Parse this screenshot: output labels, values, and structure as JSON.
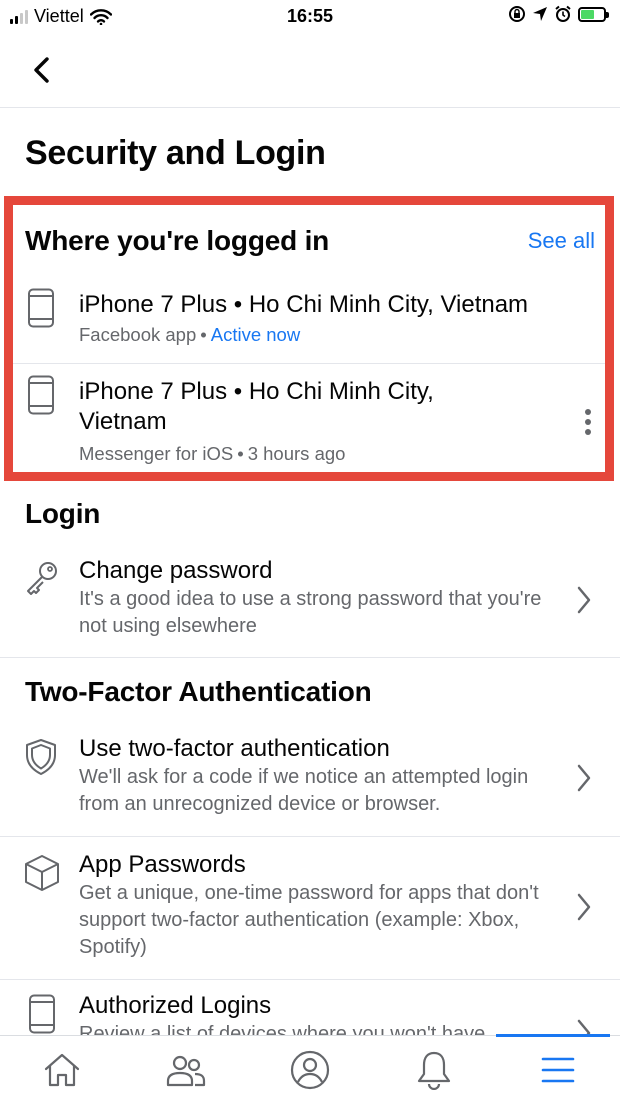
{
  "status_bar": {
    "carrier": "Viettel",
    "time": "16:55"
  },
  "page_title": "Security and Login",
  "where_logged_in": {
    "title": "Where you're logged in",
    "see_all": "See all",
    "sessions": [
      {
        "device": "iPhone 7 Plus • Ho Chi Minh City, Vietnam",
        "app": "Facebook app",
        "status": "Active now"
      },
      {
        "device": "iPhone 7 Plus • Ho Chi Minh City, Vietnam",
        "app": "Messenger for iOS",
        "status": "3 hours ago"
      }
    ]
  },
  "login_section": {
    "title": "Login",
    "items": [
      {
        "title": "Change password",
        "description": "It's a good idea to use a strong password that you're not using elsewhere",
        "icon": "key-icon"
      }
    ]
  },
  "two_factor_section": {
    "title": "Two-Factor Authentication",
    "items": [
      {
        "title": "Use two-factor authentication",
        "description": "We'll ask for a code if we notice an attempted login from an unrecognized device or browser.",
        "icon": "shield-icon"
      },
      {
        "title": "App Passwords",
        "description": "Get a unique, one-time password for apps that don't support two-factor authentication (example: Xbox, Spotify)",
        "icon": "cube-icon"
      },
      {
        "title": "Authorized Logins",
        "description": "Review a list of devices where you won't have",
        "icon": "phone-icon"
      }
    ]
  },
  "tab_bar": {
    "tabs": [
      "home-icon",
      "friends-icon",
      "profile-icon",
      "bell-icon",
      "menu-icon"
    ],
    "active_index": 4
  },
  "colors": {
    "accent": "#1877f2",
    "highlight_border": "#e5473b",
    "secondary_text": "#65676b",
    "battery_charge": "#4cd964"
  }
}
